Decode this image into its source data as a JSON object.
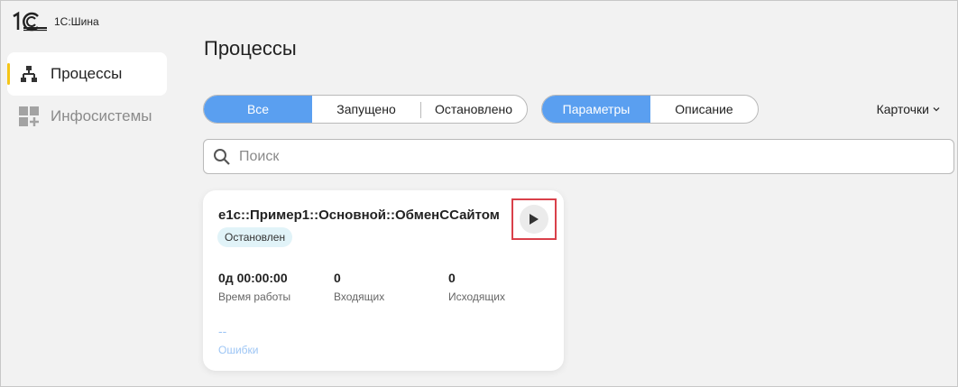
{
  "app": {
    "name": "1С:Шина"
  },
  "sidebar": {
    "items": [
      {
        "label": "Процессы",
        "icon": "hierarchy-icon",
        "active": true
      },
      {
        "label": "Инфосистемы",
        "icon": "grid-add-icon",
        "active": false
      }
    ]
  },
  "page": {
    "title": "Процессы"
  },
  "filters": {
    "status": [
      "Все",
      "Запущено",
      "Остановлено"
    ],
    "status_selected": "Все",
    "view": [
      "Параметры",
      "Описание"
    ],
    "view_selected": "Параметры"
  },
  "display_mode": {
    "label": "Карточки"
  },
  "search": {
    "placeholder": "Поиск",
    "value": ""
  },
  "cards": [
    {
      "title": "e1c::Пример1::Основной::ОбменССайтом",
      "status": "Остановлен",
      "metrics": [
        {
          "value": "0д 00:00:00",
          "label": "Время работы"
        },
        {
          "value": "0",
          "label": "Входящих"
        },
        {
          "value": "0",
          "label": "Исходящих"
        }
      ],
      "errors": {
        "value": "--",
        "label": "Ошибки"
      }
    }
  ],
  "colors": {
    "accent": "#5a9ff0",
    "indicator": "#f5c518",
    "highlight": "#d9404a",
    "badge_bg": "#e1f3f8"
  }
}
